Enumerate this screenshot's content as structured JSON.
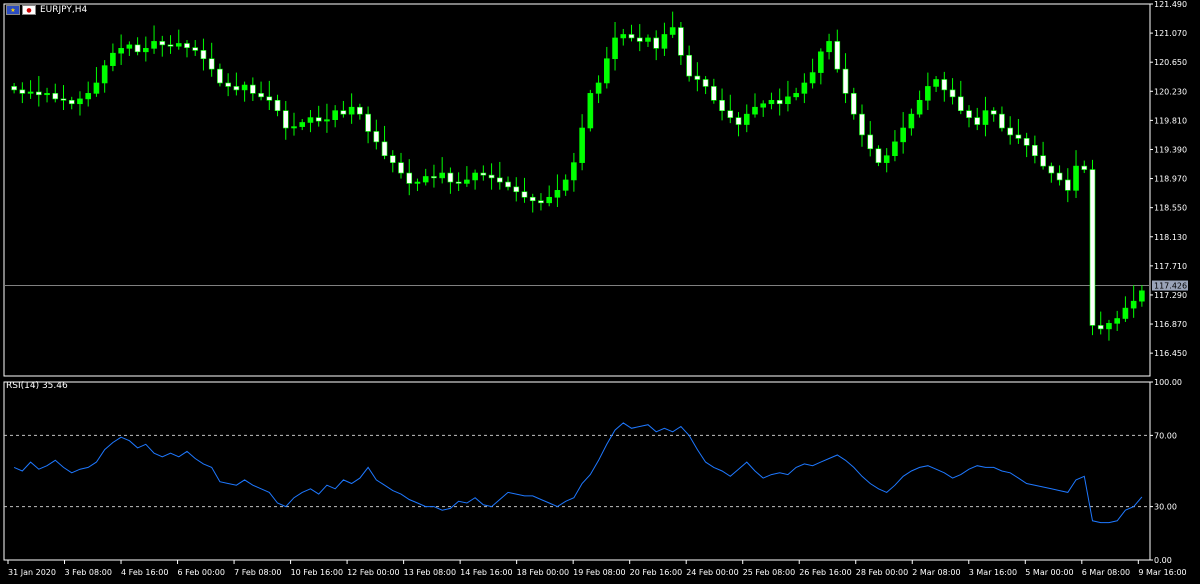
{
  "header": {
    "symbol": "EURJPY,H4"
  },
  "rsi_header": {
    "label": "RSI(14) 35.46"
  },
  "current_price": "117.426",
  "colors": {
    "bull": "#00ff00",
    "bear": "#ffffff",
    "rsi": "#1e78ff",
    "grid": "#ffffff",
    "background": "#000000"
  },
  "chart_data": [
    {
      "type": "candlestick",
      "title": "EURJPY,H4",
      "y_ticks": [
        "121.490",
        "121.070",
        "120.650",
        "120.230",
        "119.810",
        "119.390",
        "118.970",
        "118.550",
        "118.130",
        "117.710",
        "117.290",
        "116.870",
        "116.450"
      ],
      "ylim": [
        116.12,
        121.49
      ],
      "current_price": 117.426,
      "x_ticks": [
        "31 Jan 2020",
        "3 Feb 08:00",
        "4 Feb 16:00",
        "6 Feb 00:00",
        "7 Feb 08:00",
        "10 Feb 16:00",
        "12 Feb 00:00",
        "13 Feb 08:00",
        "14 Feb 16:00",
        "18 Feb 00:00",
        "19 Feb 08:00",
        "20 Feb 16:00",
        "24 Feb 00:00",
        "25 Feb 08:00",
        "26 Feb 16:00",
        "28 Feb 00:00",
        "2 Mar 08:00",
        "3 Mar 16:00",
        "5 Mar 00:00",
        "6 Mar 08:00",
        "9 Mar 16:00"
      ],
      "close_series": [
        120.25,
        120.2,
        120.22,
        120.18,
        120.2,
        120.12,
        120.1,
        120.05,
        120.12,
        120.2,
        120.35,
        120.6,
        120.78,
        120.85,
        120.9,
        120.8,
        120.85,
        120.95,
        120.9,
        120.88,
        120.92,
        120.86,
        120.82,
        120.7,
        120.55,
        120.35,
        120.3,
        120.25,
        120.32,
        120.2,
        120.15,
        120.1,
        119.95,
        119.7,
        119.72,
        119.78,
        119.85,
        119.8,
        119.82,
        119.95,
        119.9,
        120.0,
        119.9,
        119.65,
        119.5,
        119.3,
        119.2,
        119.05,
        118.9,
        118.92,
        119.0,
        118.98,
        119.05,
        118.92,
        118.9,
        118.95,
        119.05,
        119.02,
        118.98,
        118.92,
        118.85,
        118.78,
        118.7,
        118.65,
        118.62,
        118.7,
        118.8,
        118.95,
        119.2,
        119.7,
        120.2,
        120.35,
        120.7,
        121.0,
        121.05,
        121.0,
        120.95,
        121.0,
        120.85,
        121.05,
        121.15,
        120.75,
        120.45,
        120.4,
        120.3,
        120.1,
        119.95,
        119.85,
        119.75,
        119.9,
        120.0,
        120.05,
        120.1,
        120.05,
        120.15,
        120.2,
        120.35,
        120.5,
        120.8,
        120.95,
        120.55,
        120.2,
        119.9,
        119.6,
        119.4,
        119.2,
        119.3,
        119.5,
        119.7,
        119.9,
        120.1,
        120.3,
        120.4,
        120.25,
        120.15,
        119.95,
        119.85,
        119.75,
        119.95,
        119.9,
        119.7,
        119.6,
        119.55,
        119.45,
        119.3,
        119.15,
        119.05,
        118.95,
        118.8,
        119.15,
        119.1,
        116.85,
        116.8,
        116.88,
        116.95,
        117.1,
        117.2,
        117.35
      ]
    },
    {
      "type": "line",
      "title": "RSI(14) 35.46",
      "ylim": [
        0,
        100
      ],
      "y_ticks": [
        "100.00",
        "70.00",
        "30.00",
        "0.00"
      ],
      "levels": [
        70,
        30
      ],
      "series": [
        {
          "values": [
            52,
            50,
            55,
            51,
            53,
            56,
            52,
            49,
            51,
            52,
            55,
            62,
            66,
            69,
            67,
            63,
            65,
            60,
            58,
            60,
            58,
            61,
            57,
            54,
            52,
            44,
            43,
            42,
            45,
            42,
            40,
            38,
            32,
            30,
            35,
            38,
            40,
            37,
            42,
            40,
            45,
            43,
            46,
            52,
            45,
            42,
            39,
            37,
            34,
            32,
            30,
            30,
            28,
            29,
            33,
            32,
            35,
            31,
            30,
            34,
            38,
            37,
            36,
            36,
            34,
            32,
            30,
            33,
            35,
            43,
            48,
            56,
            65,
            73,
            77,
            74,
            75,
            76,
            72,
            74,
            72,
            75,
            70,
            62,
            55,
            52,
            50,
            47,
            51,
            55,
            50,
            46,
            48,
            49,
            48,
            52,
            54,
            53,
            55,
            57,
            59,
            56,
            52,
            47,
            43,
            40,
            38,
            42,
            47,
            50,
            52,
            53,
            51,
            49,
            46,
            48,
            51,
            53,
            52,
            52,
            50,
            49,
            46,
            43,
            42,
            41,
            40,
            39,
            38,
            45,
            47,
            22,
            21,
            21,
            22,
            28,
            30,
            35.46
          ]
        }
      ]
    }
  ]
}
